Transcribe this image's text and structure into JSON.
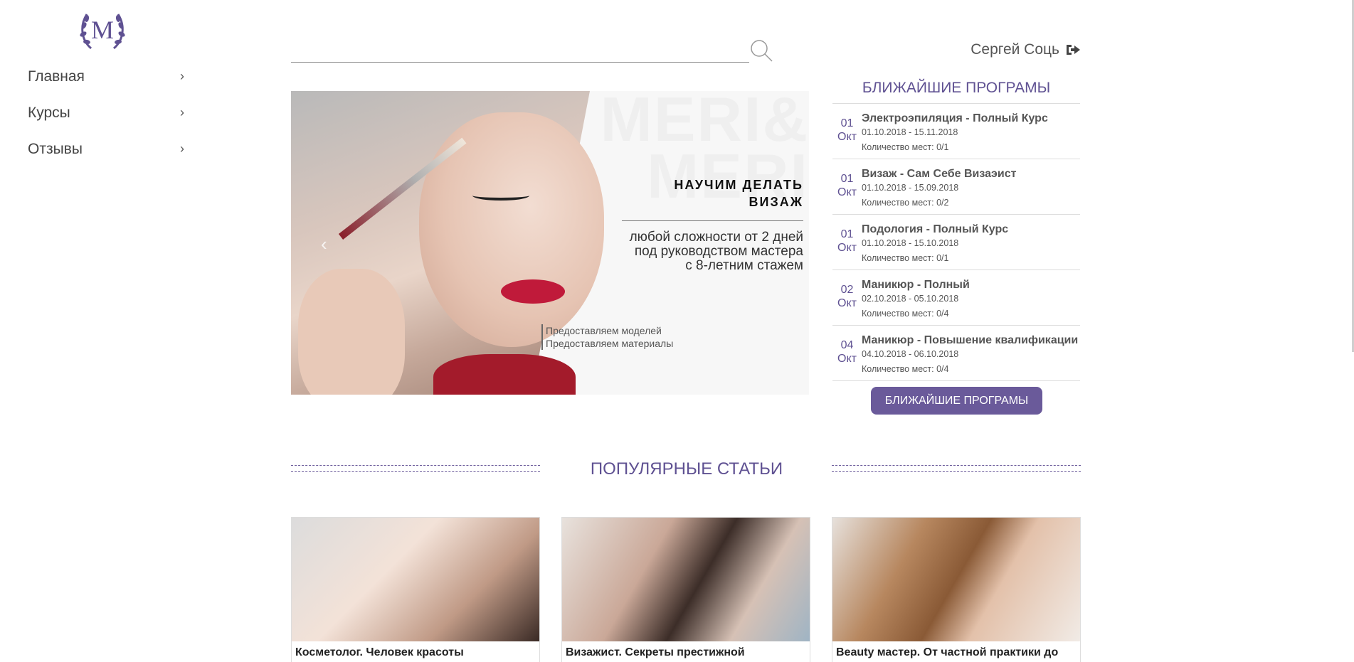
{
  "logo": {
    "letter": "M",
    "color": "#5f5192"
  },
  "sidebar": {
    "items": [
      {
        "label": "Главная"
      },
      {
        "label": "Курсы"
      },
      {
        "label": "Отзывы"
      }
    ]
  },
  "search": {
    "value": "",
    "placeholder": ""
  },
  "user": {
    "name": "Сергей Соць"
  },
  "banner": {
    "watermark_line1": "MERI&",
    "watermark_line2": "MERI",
    "headline_line1": "НАУЧИМ ДЕЛАТЬ",
    "headline_line2": "ВИЗАЖ",
    "sub_line1": "любой сложности от 2 дней",
    "sub_line2": "под руководством мастера",
    "sub_line3": "с 8-летним стажем",
    "note_line1": "Предоставляем моделей",
    "note_line2": "Предоставляем материалы"
  },
  "programs": {
    "title": "БЛИЖАЙШИЕ ПРОГРАМЫ",
    "button": "БЛИЖАЙШИЕ ПРОГРАМЫ",
    "items": [
      {
        "day": "01",
        "month": "Окт",
        "name": "Электроэпиляция - Полный Курс",
        "range": "01.10.2018 - 15.11.2018",
        "seats": "Количество мест: 0/1"
      },
      {
        "day": "01",
        "month": "Окт",
        "name": "Визаж - Сам Себе Визаэист",
        "range": "01.10.2018 - 15.09.2018",
        "seats": "Количество мест: 0/2"
      },
      {
        "day": "01",
        "month": "Окт",
        "name": "Подология - Полный Курс",
        "range": "01.10.2018 - 15.10.2018",
        "seats": "Количество мест: 0/1"
      },
      {
        "day": "02",
        "month": "Окт",
        "name": "Маникюр - Полный",
        "range": "02.10.2018 - 05.10.2018",
        "seats": "Количество мест: 0/4"
      },
      {
        "day": "04",
        "month": "Окт",
        "name": "Маникюр - Повышение квалификации",
        "range": "04.10.2018 - 06.10.2018",
        "seats": "Количество мест: 0/4"
      }
    ]
  },
  "popular": {
    "title": "ПОПУЛЯРНЫЕ СТАТЬИ",
    "cards": [
      {
        "caption": "Косметолог. Человек красоты"
      },
      {
        "caption": "Визажист. Секреты престижной"
      },
      {
        "caption": "Beauty мастер. От частной практики до"
      }
    ]
  },
  "colors": {
    "accent": "#6a5a9a",
    "accent_text": "#5f5192"
  }
}
